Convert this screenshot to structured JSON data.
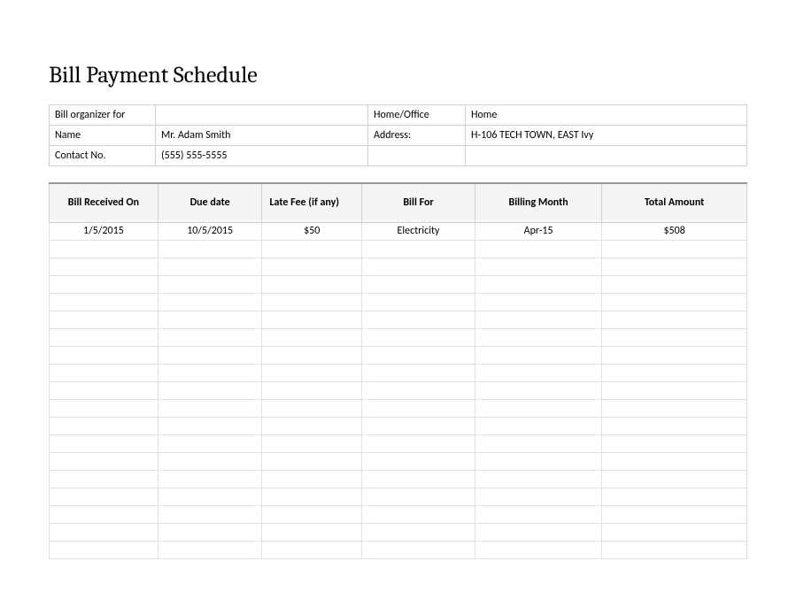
{
  "title": "Bill Payment Schedule",
  "info": {
    "organizer_label": "Bill organizer for",
    "organizer_value": "",
    "home_office_label": "Home/Office",
    "home_office_value": "Home",
    "name_label": "Name",
    "name_value": "Mr. Adam Smith",
    "address_label": "Address:",
    "address_value": "H-106 TECH TOWN, EAST Ivy",
    "contact_label": "Contact No.",
    "contact_value": "(555) 555-5555"
  },
  "schedule": {
    "headers": {
      "received": "Bill Received On",
      "due": "Due date",
      "late_fee": "Late Fee (if any)",
      "bill_for": "Bill For",
      "billing_month": "Billing Month",
      "total": "Total Amount"
    },
    "rows": [
      {
        "received": "1/5/2015",
        "due": "10/5/2015",
        "late_fee": "$50",
        "bill_for": "Electricity",
        "billing_month": "Apr-15",
        "total": "$508"
      },
      {
        "received": "",
        "due": "",
        "late_fee": "",
        "bill_for": "",
        "billing_month": "",
        "total": ""
      },
      {
        "received": "",
        "due": "",
        "late_fee": "",
        "bill_for": "",
        "billing_month": "",
        "total": ""
      },
      {
        "received": "",
        "due": "",
        "late_fee": "",
        "bill_for": "",
        "billing_month": "",
        "total": ""
      },
      {
        "received": "",
        "due": "",
        "late_fee": "",
        "bill_for": "",
        "billing_month": "",
        "total": ""
      },
      {
        "received": "",
        "due": "",
        "late_fee": "",
        "bill_for": "",
        "billing_month": "",
        "total": ""
      },
      {
        "received": "",
        "due": "",
        "late_fee": "",
        "bill_for": "",
        "billing_month": "",
        "total": ""
      },
      {
        "received": "",
        "due": "",
        "late_fee": "",
        "bill_for": "",
        "billing_month": "",
        "total": ""
      },
      {
        "received": "",
        "due": "",
        "late_fee": "",
        "bill_for": "",
        "billing_month": "",
        "total": ""
      },
      {
        "received": "",
        "due": "",
        "late_fee": "",
        "bill_for": "",
        "billing_month": "",
        "total": ""
      },
      {
        "received": "",
        "due": "",
        "late_fee": "",
        "bill_for": "",
        "billing_month": "",
        "total": ""
      },
      {
        "received": "",
        "due": "",
        "late_fee": "",
        "bill_for": "",
        "billing_month": "",
        "total": ""
      },
      {
        "received": "",
        "due": "",
        "late_fee": "",
        "bill_for": "",
        "billing_month": "",
        "total": ""
      },
      {
        "received": "",
        "due": "",
        "late_fee": "",
        "bill_for": "",
        "billing_month": "",
        "total": ""
      },
      {
        "received": "",
        "due": "",
        "late_fee": "",
        "bill_for": "",
        "billing_month": "",
        "total": ""
      },
      {
        "received": "",
        "due": "",
        "late_fee": "",
        "bill_for": "",
        "billing_month": "",
        "total": ""
      },
      {
        "received": "",
        "due": "",
        "late_fee": "",
        "bill_for": "",
        "billing_month": "",
        "total": ""
      },
      {
        "received": "",
        "due": "",
        "late_fee": "",
        "bill_for": "",
        "billing_month": "",
        "total": ""
      },
      {
        "received": "",
        "due": "",
        "late_fee": "",
        "bill_for": "",
        "billing_month": "",
        "total": ""
      }
    ]
  }
}
